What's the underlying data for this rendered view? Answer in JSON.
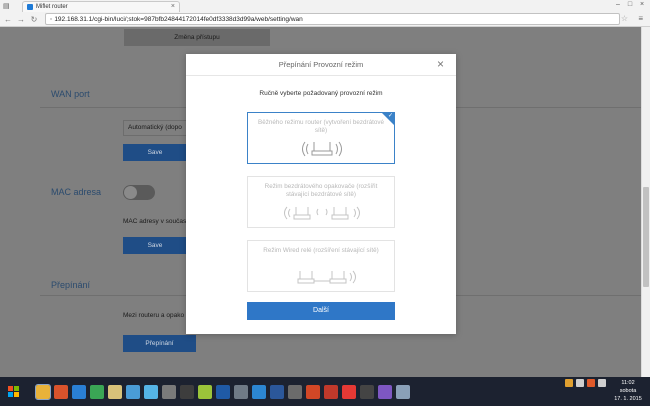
{
  "browser": {
    "tab_title": "Miflet router",
    "url": "192.168.31.1/cgi-bin/luci/;stok=987bfb24844172014fe0df3338d3d99a/web/setting/wan"
  },
  "page": {
    "change_access_button": "Změna přístupu",
    "wan": {
      "heading": "WAN port",
      "select_value": "Automatický (dopo",
      "save_button": "Save"
    },
    "mac": {
      "heading": "MAC adresa",
      "text": "MAC adresy v součas",
      "save_button": "Save"
    },
    "switch": {
      "heading": "Přepínání",
      "text": "Mezi routeru a opako",
      "button": "Přepínání"
    }
  },
  "modal": {
    "title": "Přepínání Provozní režim",
    "subtitle": "Ručně vyberte požadovaný provozní režim",
    "options": [
      {
        "label": "Běžného režimu router (vytvoření bezdrátové sítě)",
        "selected": true
      },
      {
        "label": "Režim bezdrátového opakovače (rozšířit stávající bezdrátové sítě)",
        "selected": false
      },
      {
        "label": "Režim Wired relé (rozšíření stávající sítě)",
        "selected": false
      }
    ],
    "next_button": "Další",
    "accent": "#2f77c7"
  },
  "taskbar": {
    "clock_time": "11:02",
    "clock_day": "sobota",
    "clock_date": "17. 1. 2015"
  }
}
